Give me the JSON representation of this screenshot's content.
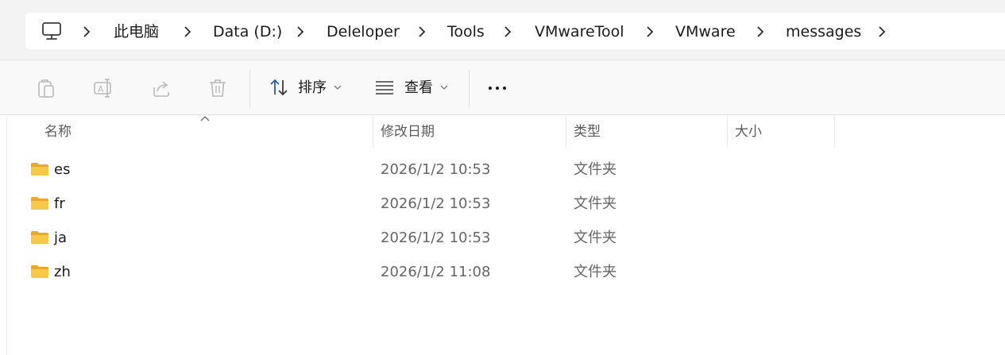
{
  "breadcrumb": {
    "items": [
      {
        "label": "此电脑"
      },
      {
        "label": "Data (D:)"
      },
      {
        "label": "Deleloper"
      },
      {
        "label": "Tools"
      },
      {
        "label": "VMwareTool"
      },
      {
        "label": "VMware"
      },
      {
        "label": "messages"
      }
    ],
    "root_icon": "computer-icon",
    "separator_icon": "chevron-right-icon"
  },
  "toolbar": {
    "disabled_icons": [
      "copy-icon",
      "rename-icon",
      "share-icon",
      "delete-icon"
    ],
    "sort_label": "排序",
    "view_label": "查看",
    "more_icon": "more-icon"
  },
  "columns": {
    "name": "名称",
    "date": "修改日期",
    "type": "类型",
    "size": "大小"
  },
  "files": [
    {
      "name": "es",
      "date": "2026/1/2 10:53",
      "type": "文件夹"
    },
    {
      "name": "fr",
      "date": "2026/1/2 10:53",
      "type": "文件夹"
    },
    {
      "name": "ja",
      "date": "2026/1/2 10:53",
      "type": "文件夹"
    },
    {
      "name": "zh",
      "date": "2026/1/2 11:08",
      "type": "文件夹"
    }
  ],
  "colors": {
    "address_bg": "#f3f3f3",
    "accent_blue": "#1f5fa8",
    "folder_yellow": "#f7c948",
    "disabled_icon": "#b9b9b9"
  }
}
